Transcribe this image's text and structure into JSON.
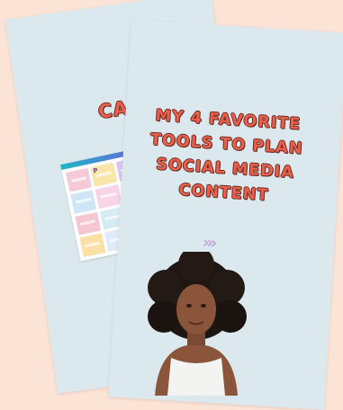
{
  "back_card": {
    "title": "CANVA",
    "app_preview": {
      "tile_letter": "P",
      "tile_colors": [
        "#f6c9d9",
        "#f9e6a8",
        "#d9c3f2",
        "#fbd6c1",
        "#cfe6f7",
        "#f7d5e6",
        "#e6dcfb",
        "#fde7b9",
        "#f4c7d3",
        "#d6ecf3",
        "#f8dfc9",
        "#e9d4f5",
        "#fbe0a6",
        "#dfeafb",
        "#f6cfe0",
        "#e7f3da"
      ]
    }
  },
  "front_card": {
    "title_lines": [
      "MY 4 FAVORITE",
      "TOOLS TO PLAN",
      "SOCIAL MEDIA",
      "CONTENT"
    ],
    "arrows": "›››"
  },
  "colors": {
    "background": "#fbe3d6",
    "card": "#dbe9ef",
    "headline": "#e8604c",
    "headline_outline": "#6b2b22",
    "arrows": "#c2a6d8"
  }
}
